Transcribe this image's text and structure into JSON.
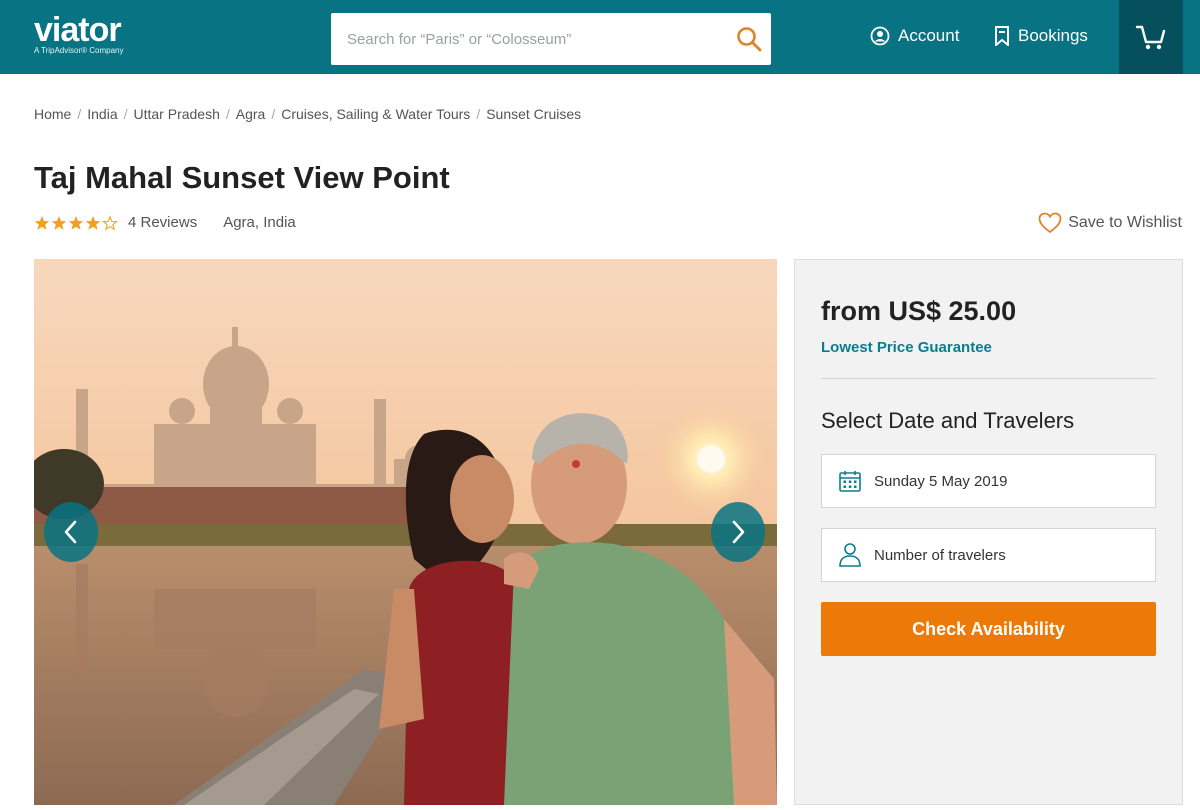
{
  "brand": {
    "name": "viator",
    "tagline": "A TripAdvisor® Company",
    "primary_color": "#087383",
    "accent_color": "#ec7a08"
  },
  "header": {
    "search_placeholder": "Search for “Paris” or “Colosseum”",
    "account_label": "Account",
    "bookings_label": "Bookings",
    "icons": [
      "search-icon",
      "account-icon",
      "bookings-icon",
      "cart-icon"
    ]
  },
  "breadcrumb": [
    "Home",
    "India",
    "Uttar Pradesh",
    "Agra",
    "Cruises, Sailing & Water Tours",
    "Sunset Cruises"
  ],
  "product": {
    "title": "Taj Mahal Sunset View Point",
    "rating": 4,
    "rating_max": 5,
    "reviews_label": "4 Reviews",
    "location": "Agra, India",
    "wishlist_label": "Save to Wishlist"
  },
  "booking": {
    "price_label": "from US$ 25.00",
    "guarantee_label": "Lowest Price Guarantee",
    "select_title": "Select Date and Travelers",
    "date_value": "Sunday 5 May 2019",
    "travelers_placeholder": "Number of travelers",
    "cta_label": "Check Availability"
  }
}
